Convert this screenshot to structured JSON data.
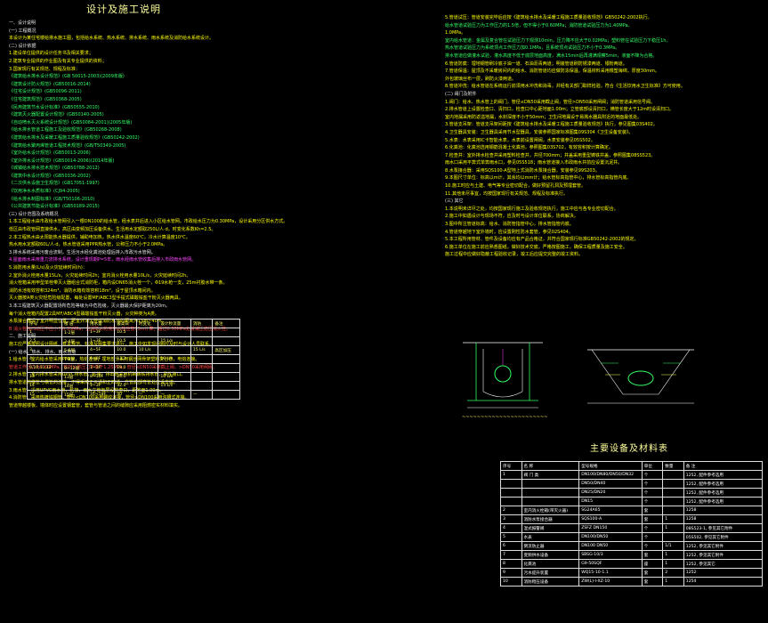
{
  "left_title": "设计及施工说明",
  "equip_title": "主要设备及材料表",
  "left_lines": [
    {
      "t": "一、设计说明",
      "c": "w"
    },
    {
      "t": "(一) 工程概况",
      "c": "w"
    },
    {
      "t": "    本设计为某住宅楼给排水施工图，包括给水系统、热水系统、排水系统、雨水系统及消防给水系统设计。",
      "c": "y"
    },
    {
      "t": "(二) 设计依据",
      "c": "w"
    },
    {
      "t": "1.建设单位提供的设计任务书及相关要求；",
      "c": "y"
    },
    {
      "t": "2.建筑专业提供的作业图及有关专业提供的资料；",
      "c": "y"
    },
    {
      "t": "3.国家现行有关规范、规程及标准：",
      "c": "y"
    },
    {
      "t": "《建筑给水排水设计规范》(GB 50015-2003)(2009年版)",
      "c": "g"
    },
    {
      "t": "《建筑设计防火规范》(GB50016-2014)",
      "c": "g"
    },
    {
      "t": "《住宅设计规范》(GB50096-2011)",
      "c": "g"
    },
    {
      "t": "《住宅建筑规范》(GB50368-2005)",
      "c": "g"
    },
    {
      "t": "《民用建筑节水设计标准》(GB50555-2010)",
      "c": "g"
    },
    {
      "t": "《建筑灭火器配置设计规范》(GB50140-2005)",
      "c": "g"
    },
    {
      "t": "《自动喷水灭火系统设计规范》(GB50084-2001)(2005年版)",
      "c": "g"
    },
    {
      "t": "《给水排水管道工程施工及验收规范》(GB50268-2008)",
      "c": "g"
    },
    {
      "t": "《建筑给水排水及采暖工程施工质量验收规范》(GB50242-2002)",
      "c": "g"
    },
    {
      "t": "《建筑给水聚丙烯管道工程技术规范》(GB/T50349-2005)",
      "c": "g"
    },
    {
      "t": "《室外给水设计规范》(GB50013-2006)",
      "c": "g"
    },
    {
      "t": "《室外排水设计规范》(GB50014-2006)(2014年版)",
      "c": "g"
    },
    {
      "t": "《城镇给水排水技术规范》(GB50788-2012)",
      "c": "g"
    },
    {
      "t": "《建筑中水设计规范》(GB50336-2002)",
      "c": "g"
    },
    {
      "t": "《二次供水设施卫生规范》(GB17051-1997)",
      "c": "g"
    },
    {
      "t": "《饮用净水水质标准》(CJ94-2005)",
      "c": "g"
    },
    {
      "t": "《给水排水制图标准》(GB/T50106-2010)",
      "c": "g"
    },
    {
      "t": "《公共建筑节能设计标准》(GB50189-2015)",
      "c": "g"
    },
    {
      "t": "(三) 设计范围及系统概况",
      "c": "w"
    },
    {
      "t": "1.本工程给水由市政给水管网引入一根DN100的给水管，经水表井后进入小区给水管网。市政给水压力为0.30MPa，设计采用分区供水方式。",
      "c": "y"
    },
    {
      "t": "  低区由市政管网直接供水，高区由变频加压设备供水。生活用水定额取250L/人·d，时变化系数Kh=2.5。",
      "c": "y"
    },
    {
      "t": "2.本工程热水由太阳能热水器提供，辅助电加热，热水供水温度60℃，冷水计算温度10℃。",
      "c": "y"
    },
    {
      "t": "  热水用水定额取60L/人·d，热水管道采用PPR热水管，公称压力不小于2.0MPa。",
      "c": "y"
    },
    {
      "t": "3.排水系统采用污废合流制，生活污水经化粪池处理后排入市政污水管网。",
      "c": "w"
    },
    {
      "t": "4.屋面雨水采用重力流排水系统，设计重现期P=5年，雨水经雨水管收集后排入市政雨水管网。",
      "c": "m"
    },
    {
      "t": "5.消防用水量(L/s)及火灾延续时间(h)：",
      "c": "y"
    },
    {
      "t": "2.室外消火栓用水量15L/s，火灾延续时间2h；室内消火栓用水量10L/s，火灾延续时间2h。",
      "c": "y"
    },
    {
      "t": "  消火栓箱采用甲型单栓带灭火器组合式消防柜，箱内设DN65消火栓一个，Φ19水枪一支，25m衬胶水带一条。",
      "c": "y"
    },
    {
      "t": "  消防水池有效容积324m³，消防水箱有效容积18m³，设于屋顶水箱间内。",
      "c": "y"
    },
    {
      "t": "  灭火器按A类火灾轻危险级配置，每处设置MF/ABC3型手提式磷酸铵盐干粉灭火器两具。",
      "c": "y"
    },
    {
      "t": "3.本工程建筑灭火器配置场所危险等级为中危险级，灭火器最大保护距离为20m。",
      "c": "w"
    },
    {
      "t": "  每个消火栓箱内配置2具MF/ABC4型磷酸铵盐干粉灭火器，火灾种类为A类。",
      "c": "y"
    },
    {
      "t": "  水泵接合器设于室外明显位置，距室外消火栓或消防水池的距离为15m~40m。",
      "c": "y"
    },
    {
      "t": "B  消火栓栓口动压不应小于0.35MPa，且消防水枪充实水柱应按13m计算；超过0.50MPa处设减压稳压消火栓。",
      "c": "r"
    },
    {
      "t": "二、施工说明",
      "c": "w"
    },
    {
      "t": "    施工应严格按照设计图纸、有关规范、标准及图集要求进行，施工中如发现问题应及时与设计人员联系。",
      "c": "y"
    },
    {
      "t": "(一) 给水、热水、排水、雨水管道",
      "c": "w"
    },
    {
      "t": "1.给水管：室内给水管采用PPR管，热熔连接；埋地部分采用钢丝网骨架塑料复合管，电熔连接。",
      "c": "y"
    },
    {
      "t": "  管道工作压力为0.60MPa，管材公称压力不低于1.25MPa；管径≤DN50采用截止阀，>DN50采用闸阀。",
      "c": "r"
    },
    {
      "t": "2.排水管：室内排水管采用UPVC排水管，粘接；排出管采用机制铸铁排水管，柔性接口。",
      "c": "y"
    },
    {
      "t": "  排水管道的横管与横管的连接，不得采用正三通和正四通；立管底部弯管处应设支墩。",
      "c": "y"
    },
    {
      "t": "3.雨水管：采用UPVC雨水管，粘接，雨水立管每层设检查口，距地面1.00m。",
      "c": "y"
    },
    {
      "t": "4.消防管：采用热镀锌钢管，管径<DN100采用螺纹连接，管径≥DN100采用沟槽式连接。",
      "c": "y"
    },
    {
      "t": "  管道穿越楼板、墙体时应设置钢套管，套管与管道之间的缝隙应采用阻燃密实材料填实。",
      "c": "y"
    }
  ],
  "right_lines": [
    {
      "t": "5.管道试压：管道安装完毕后应按《建筑给水排水及采暖工程施工质量验收规范》GB50242-2002执行。",
      "c": "y"
    },
    {
      "t": "  给水管道试验压力为工作压力的1.5倍，但不得小于0.60MPa；消防管道试验压力为1.40MPa。",
      "c": "g"
    },
    {
      "t": "1.0MPa。",
      "c": "y"
    },
    {
      "t": "  室内给水管道：金属及复合管在试验压力下观测10min，压力降不应大于0.02MPa；塑料管在试验压力下稳压1h。",
      "c": "g"
    },
    {
      "t": "  热水管道试验压力为系统顶点工作压力加0.1MPa，且系统顶点试验压力不小于0.3MPa。",
      "c": "g"
    },
    {
      "t": "  排水管道应做灌水试验，灌水高度不低于底层地面高度，满水15min后再灌满观察5min，液面不降为合格。",
      "c": "g"
    },
    {
      "t": "6.管道防腐：埋地钢管刷冷底子油一道、石油沥青两道；明装管道刷防锈漆两道、银粉两道。",
      "c": "y"
    },
    {
      "t": "7.管道保温：屋顶及不采暖房间内的给水、消防管道均应做防冻保温，保温材料采用橡塑海绵，厚度30mm。",
      "c": "y"
    },
    {
      "t": "  外包玻璃丝布一层，刷防火漆两道。",
      "c": "y"
    },
    {
      "t": "8.管道冲洗：给水管道在系统运行前须用水冲洗和消毒，并经有关部门取样检验，符合《生活饮用水卫生标准》方可使用。",
      "c": "y"
    },
    {
      "t": "(二) 阀门及附件",
      "c": "w"
    },
    {
      "t": "1.阀门：给水、热水管上的阀门，管径≤DN50采用截止阀，管径>DN50采用闸阀；消防管道采用信号阀。",
      "c": "y"
    },
    {
      "t": "2.排水管道上设置检查口、清扫口，检查口中心距地面1.00m；立管底部设清扫口，横管长度大于12m时设清扫口。",
      "c": "y"
    },
    {
      "t": "  室内地漏采用防返溢地漏，水封深度不小于50mm；卫生间地漏设于易溅水器具附近的地面最低处。",
      "c": "y"
    },
    {
      "t": "3.管道支吊架：管道支吊架间距按《建筑给水排水及采暖工程施工质量验收规范》执行，参见图集03S402。",
      "c": "y"
    },
    {
      "t": "4.卫生器具安装：卫生器具采用节水型器具，安装参照国家标准图集09S304《卫生设备安装》。",
      "c": "y"
    },
    {
      "t": "5.水表：水表采用IC卡智能水表，水表前设置闸阀，水表安装参见05S502。",
      "c": "y"
    },
    {
      "t": "6.化粪池：化粪池选用钢筋混凝土化粪池，参照图集03S702，有效容积按计算确定。",
      "c": "y"
    },
    {
      "t": "7.检查井：室外排水检查井采用塑料检查井，井径700mm；井盖采用重型铸铁井盖，参照图集08SS523。",
      "c": "y"
    },
    {
      "t": "  雨水口采用平箅式单箅雨水口，参见05S518；雨水管道接入市政雨水井前应设置沉泥井。",
      "c": "y"
    },
    {
      "t": "8.水泵接合器：采用SQS100-A型地上式消防水泵接合器，安装参见99S203。",
      "c": "y"
    },
    {
      "t": "9.本图尺寸单位：标高以m计，其余均以mm计；给水管标高指管中心，排水管标高指管内底。",
      "c": "y"
    },
    {
      "t": "10.施工时应与土建、电气等专业密切配合，做好预留孔洞及预埋套管。",
      "c": "y"
    },
    {
      "t": "11.其他未尽事宜，均按国家现行有关规范、规程及标准执行。",
      "c": "y"
    },
    {
      "t": "(三) 其它",
      "c": "w"
    },
    {
      "t": "1.本说明未详尽之处，均按国家现行施工及验收规范执行，施工中应与各专业密切配合。",
      "c": "y"
    },
    {
      "t": "2.施工中如遇设计与现场不符，应及时与设计单位联系，协商解决。",
      "c": "y"
    },
    {
      "t": "3.图中所注管道标高：给水、消防管指管中心，排水管指管内底。",
      "c": "y"
    },
    {
      "t": "4.管道穿越地下室外墙时，应设置刚性防水套管，参见02S404。",
      "c": "y"
    },
    {
      "t": "5.本工程所用管材、管件及设备均应有产品合格证，并符合国家现行标准GB50242-2002的规定。",
      "c": "y"
    },
    {
      "t": "6.施工单位在施工前应熟悉图纸，做好技术交底，严格按图施工，确保工程质量及施工安全。",
      "c": "y"
    },
    {
      "t": "  施工过程中应做好隐蔽工程验收记录，竣工后应提交完整的竣工资料。",
      "c": "y"
    }
  ],
  "flow_table": {
    "header": [
      "序号",
      "楼 层",
      "用水量",
      "最高日",
      "时变化",
      "设计秒流量",
      "消防",
      "备注"
    ],
    "rows": [
      [
        "1",
        "1-2层",
        "1~3F",
        "10.5",
        "",
        "",
        "",
        ""
      ],
      [
        "2,5",
        "3-4层",
        "1~3F",
        "10.5",
        "",
        "15 L/s",
        "",
        ""
      ],
      [
        "3",
        "5-6层",
        "4~5F",
        "10.0",
        "10 L/s",
        "",
        "15 L/s",
        "高区加压"
      ],
      [
        "4",
        "7-8层",
        "6~8F",
        "13.2",
        "",
        "10 L/s",
        "",
        ""
      ],
      [
        "9,10,11,12",
        "9~12层",
        "1~3F",
        "18.0",
        "",
        "",
        "",
        ""
      ],
      [
        "13",
        "13层",
        "8~10F",
        "24.0",
        "",
        "10 L/s",
        "",
        ""
      ],
      [
        "14",
        "14层",
        "1~3F",
        "32.0",
        "",
        "15 L/s",
        "",
        ""
      ],
      [
        "15",
        "15层",
        "16~18F",
        "40",
        "—",
        "—",
        "—",
        ""
      ]
    ]
  },
  "equip_table": {
    "header": [
      "序号",
      "名  称",
      "型号规格",
      "单位",
      "数量",
      "备  注"
    ],
    "rows": [
      [
        "1",
        "阀 门 类",
        "DN100/DN80/DN50/DN32",
        "个",
        "",
        "1252, 配件参考选用"
      ],
      [
        "",
        "",
        "DN50/DN40",
        "个",
        "",
        "1252, 配件参考选用"
      ],
      [
        "",
        "",
        "DN25/DN20",
        "个",
        "",
        "1252, 配件参考选用"
      ],
      [
        "",
        "",
        "DN15",
        "个",
        "",
        "1252, 配件参考选用"
      ],
      [
        "2",
        "室内消火栓箱(带灭火器)",
        "SG24A65",
        "套",
        "",
        "1258"
      ],
      [
        "3",
        "消防水泵接合器",
        "SQS100-A",
        "套",
        "1",
        "1258"
      ],
      [
        "4",
        "湿式报警阀",
        "ZSFZ DN150",
        "个",
        "1",
        "08S523-1, 参见其它附件"
      ],
      [
        "5",
        "水表",
        "DN100/DN50",
        "个",
        "",
        "05S502, 参见其它附件"
      ],
      [
        "6",
        "倒流防止器",
        "DN100 DN50",
        "个",
        "1/1",
        "1252, 参见其它附件"
      ],
      [
        "7",
        "变频供水设备",
        "SBSG-10/3",
        "套",
        "1",
        "1252, 参见其它附件"
      ],
      [
        "8",
        "化粪池",
        "G9-50SQF",
        "座",
        "1",
        "1252, 参见其它"
      ],
      [
        "9",
        "污水提升装置",
        "WQ15-10-1.1",
        "套",
        "2",
        "1252"
      ],
      [
        "10",
        "消防稳压设备",
        "ZW(L)-I-XZ-10",
        "套",
        "1",
        "1254"
      ]
    ]
  }
}
